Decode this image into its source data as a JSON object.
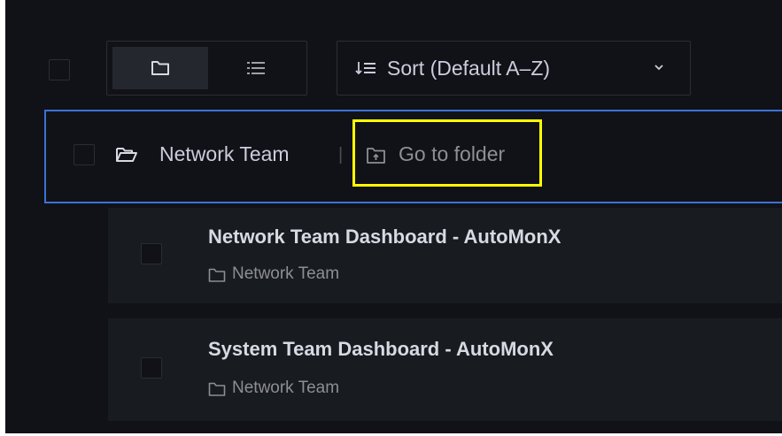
{
  "toolbar": {
    "view_folders_icon": "folder-icon",
    "view_list_icon": "list-icon",
    "sort_label": "Sort (Default A–Z)"
  },
  "folder": {
    "name": "Network Team",
    "separator": "|",
    "goto_label": "Go to folder"
  },
  "dashboards": [
    {
      "title": "Network Team Dashboard - AutoMonX",
      "folder": "Network Team"
    },
    {
      "title": "System Team Dashboard - AutoMonX",
      "folder": "Network Team"
    }
  ],
  "colors": {
    "background": "#111217",
    "card": "#181b1f",
    "selection_border": "#3d71d9",
    "highlight": "#ffff00"
  }
}
